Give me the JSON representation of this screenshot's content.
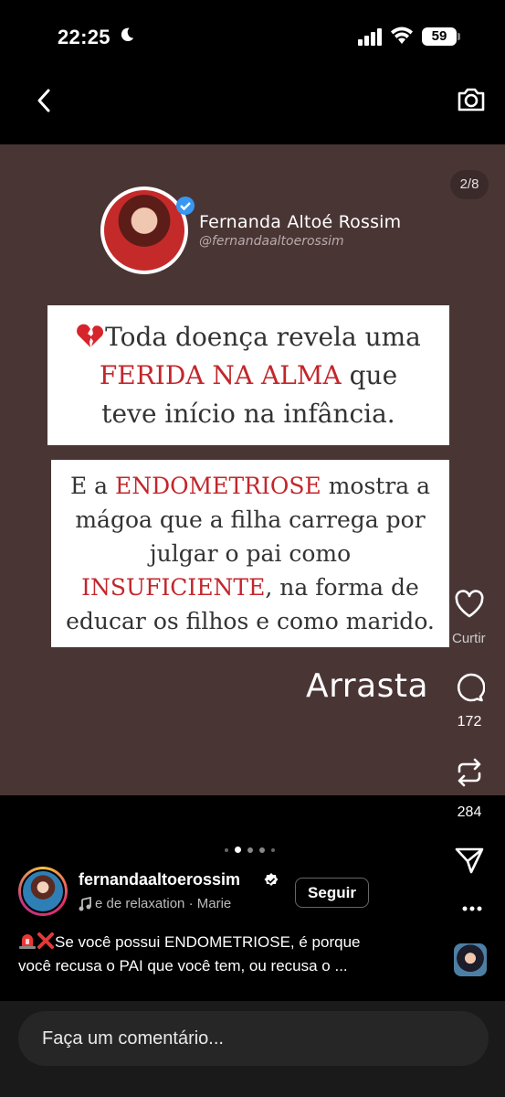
{
  "status_bar": {
    "time": "22:25",
    "battery": "59"
  },
  "post": {
    "slide_counter": "2/8",
    "author_name": "Fernanda Altoé Rossim",
    "author_handle": "@fernandaaltoerossim",
    "card1": {
      "line1": "Toda doença revela uma",
      "line2_red": "FERIDA NA ALMA",
      "line2_rest": " que",
      "line3": "teve início na infância."
    },
    "card2": {
      "line1_a": "E a ",
      "line1_red": "ENDOMETRIOSE",
      "line1_b": " mostra a",
      "line2": "mágoa que a filha carrega por",
      "line3": "julgar o pai como",
      "line4_red": "INSUFICIENTE",
      "line4_rest": ", na forma de",
      "line5": "educar os filhos e como marido."
    },
    "swipe_text": "Arrasta"
  },
  "actions": {
    "like_label": "Curtir",
    "comments": "172",
    "reposts": "284"
  },
  "pager": {
    "count": 5,
    "active": 1
  },
  "profile": {
    "username": "fernandaaltoerossim",
    "follow_label": "Seguir",
    "music": "e de relaxation · Marie"
  },
  "caption": {
    "line1": "Se você possui ENDOMETRIOSE, é porque",
    "line2": "você recusa o PAI que você tem, ou recusa o ..."
  },
  "comment_box": {
    "placeholder": "Faça um comentário..."
  },
  "colors": {
    "media_bg": "#4a3535",
    "accent_red": "#c3262b",
    "verified_blue": "#3897f0"
  }
}
